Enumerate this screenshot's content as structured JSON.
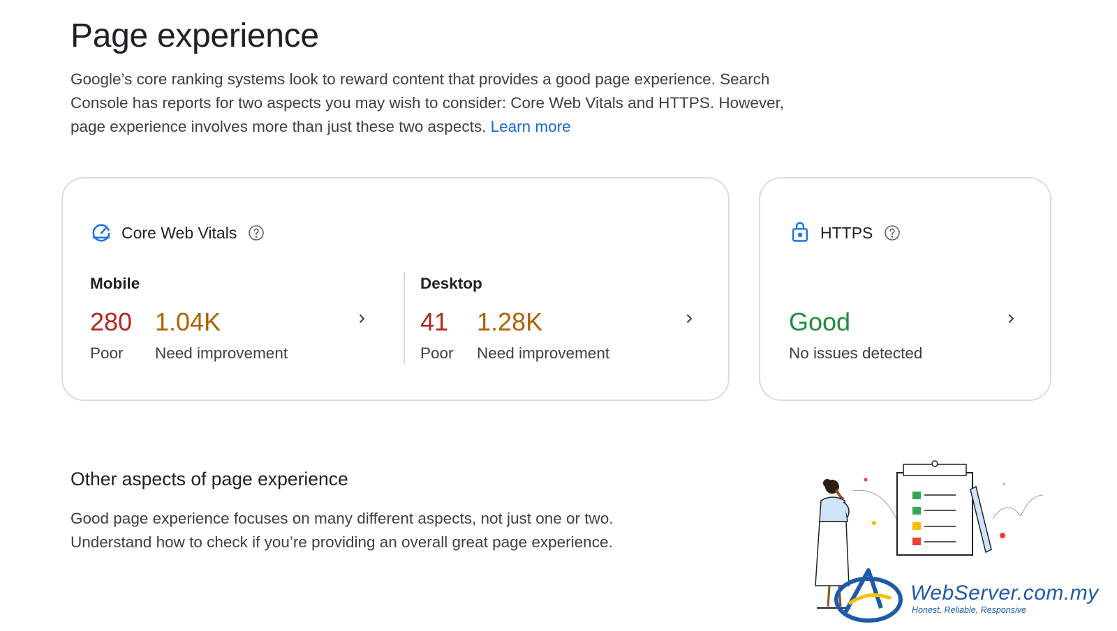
{
  "page": {
    "title": "Page experience",
    "intro": "Google’s core ranking systems look to reward content that provides a good page experience. Search Console has reports for two aspects you may wish to consider: Core Web Vitals and HTTPS. However, page experience involves more than just these two aspects.",
    "learn_more": "Learn more"
  },
  "core_web_vitals": {
    "title": "Core Web Vitals",
    "icon": "speedometer-icon",
    "mobile": {
      "label": "Mobile",
      "poor_value": "280",
      "poor_label": "Poor",
      "needs_value": "1.04K",
      "needs_label": "Need improvement"
    },
    "desktop": {
      "label": "Desktop",
      "poor_value": "41",
      "poor_label": "Poor",
      "needs_value": "1.28K",
      "needs_label": "Need improvement"
    }
  },
  "https": {
    "title": "HTTPS",
    "icon": "lock-icon",
    "status_value": "Good",
    "status_label": "No issues detected"
  },
  "other": {
    "title": "Other aspects of page experience",
    "text": "Good page experience focuses on many different aspects, not just one or two. Understand how to check if you’re providing an overall great page experience."
  },
  "watermark": {
    "name": "WebServer.com.my",
    "tagline": "Honest, Reliable, Responsive"
  },
  "colors": {
    "poor": "#b3261e",
    "needs_improvement": "#b06000",
    "good": "#1e8e3e",
    "link": "#1a66d6",
    "icon_blue": "#1a73e8"
  }
}
